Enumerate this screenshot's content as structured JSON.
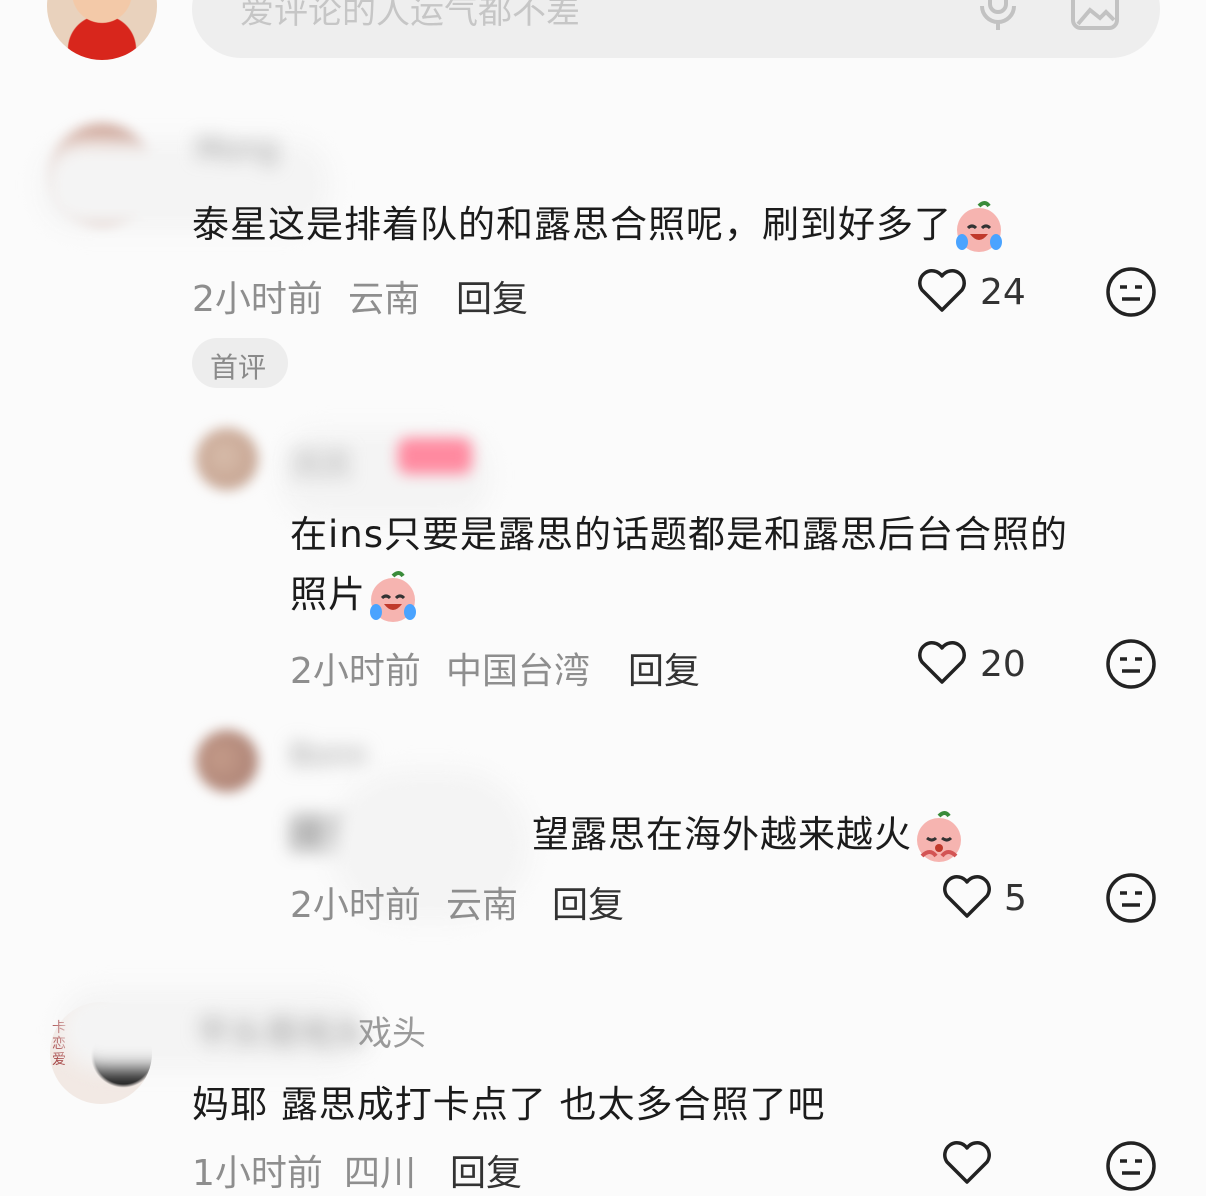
{
  "input": {
    "placeholder": "爱评论的人运气都不差"
  },
  "comments": [
    {
      "username": "Mong",
      "text": "泰星这是排着队的和露思合照呢，刷到好多了",
      "time": "2小时前",
      "location": "云南",
      "reply_label": "回复",
      "likes": "24",
      "badge": "首评"
    },
    {
      "username": "沉沉",
      "text_line1": "在ins只要是露思的话题都是和露思后台合照的",
      "text_line2": "照片",
      "time": "2小时前",
      "location": "中国台湾",
      "reply_label": "回复",
      "likes": "20"
    },
    {
      "username": "Bonn",
      "text_prefix": "回复",
      "text_visible": "望露思在海外越来越火",
      "time": "2小时前",
      "location": "云南",
      "reply_label": "回复",
      "likes": "5"
    },
    {
      "username": "平头哥戏头",
      "username_visible": "戏头",
      "text": "妈耶 露思成打卡点了 也太多合照了吧",
      "time": "1小时前",
      "location": "四川",
      "reply_label": "回复",
      "likes": ""
    }
  ],
  "icons": {
    "emoji_crying_laugh": "crying-laughing-emoji",
    "emoji_pleading": "pleading-emoji",
    "heart": "heart-outline-icon",
    "dislike": "meh-face-icon"
  }
}
